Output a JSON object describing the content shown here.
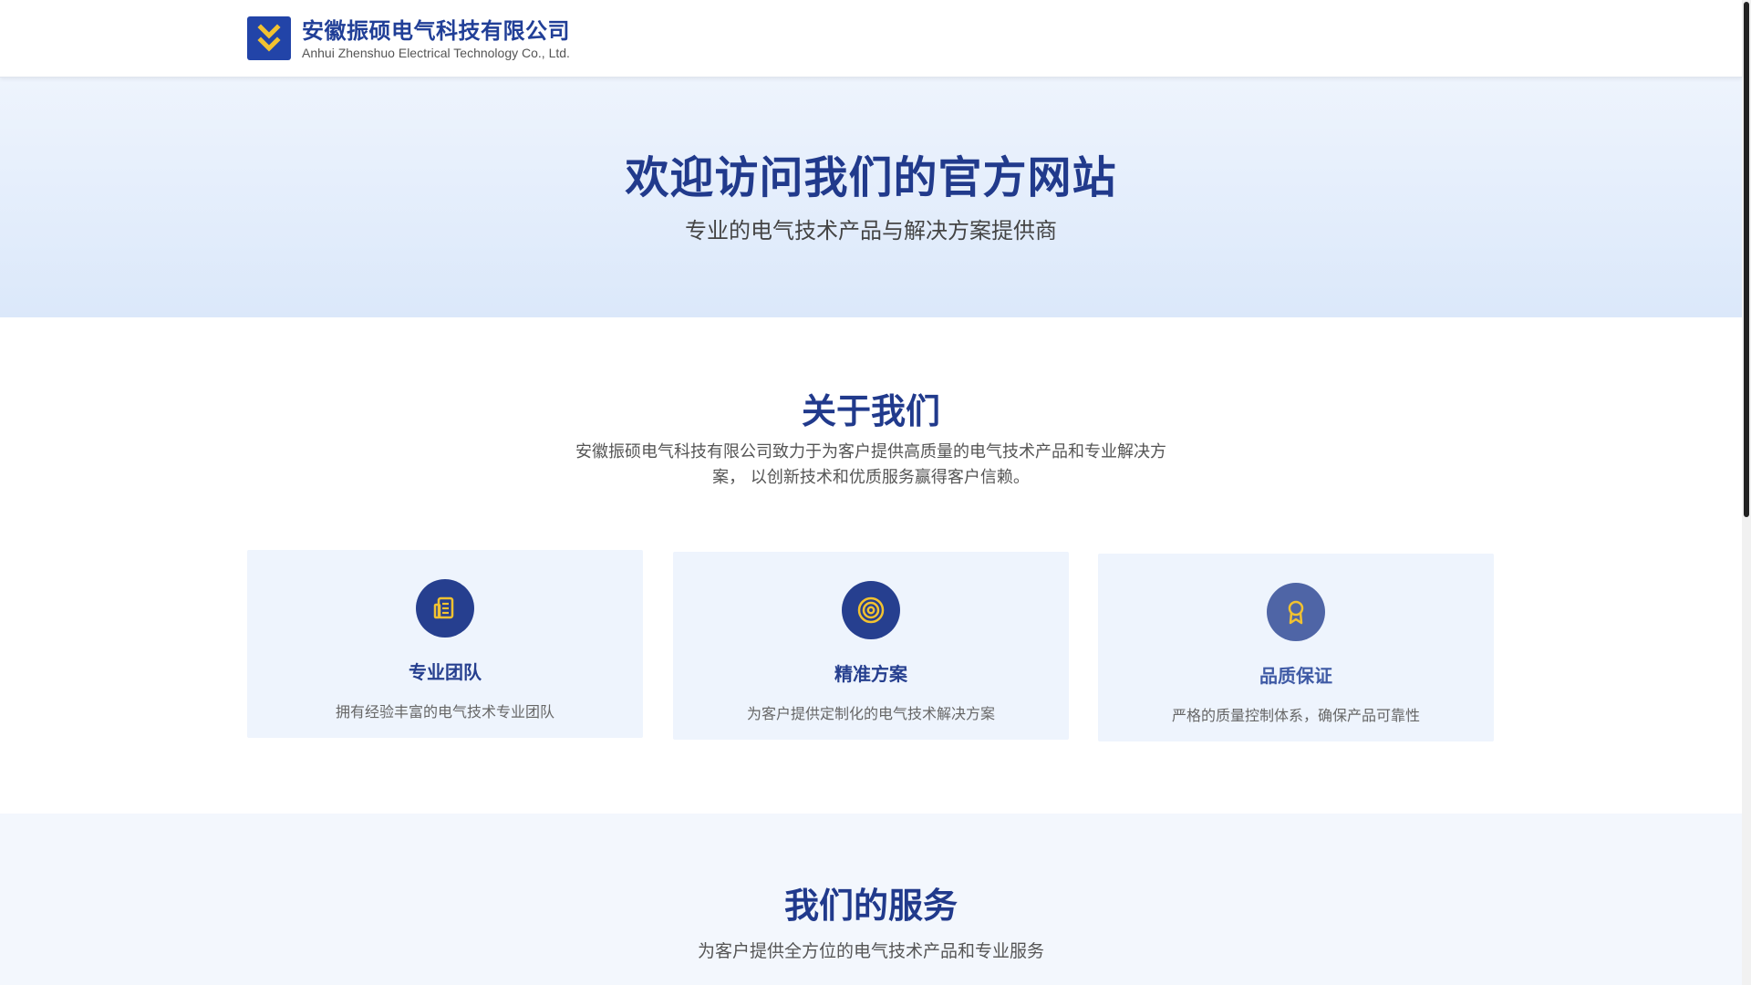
{
  "header": {
    "company_name": "安徽振硕电气科技有限公司",
    "company_name_en": "Anhui Zhenshuo Electrical Technology Co., Ltd.",
    "logo_icon": "double-chevron-down-icon"
  },
  "hero": {
    "title": "欢迎访问我们的官方网站",
    "subtitle": "专业的电气技术产品与解决方案提供商"
  },
  "about": {
    "title": "关于我们",
    "description": "安徽振硕电气科技有限公司致力于为客户提供高质量的电气技术产品和专业解决方案， 以创新技术和优质服务赢得客户信赖。",
    "cards": [
      {
        "icon": "building-icon",
        "title": "专业团队",
        "desc": "拥有经验丰富的电气技术专业团队"
      },
      {
        "icon": "target-icon",
        "title": "精准方案",
        "desc": "为客户提供定制化的电气技术解决方案"
      },
      {
        "icon": "award-ribbon-icon",
        "title": "品质保证",
        "desc": "严格的质量控制体系，确保产品可靠性"
      }
    ]
  },
  "services": {
    "title": "我们的服务",
    "subtitle": "为客户提供全方位的电气技术产品和专业服务"
  },
  "colors": {
    "brand_blue": "#213a8c",
    "icon_gold": "#f2c230",
    "hero_bg": "#e4eefb",
    "card_bg": "#eef4fd"
  }
}
